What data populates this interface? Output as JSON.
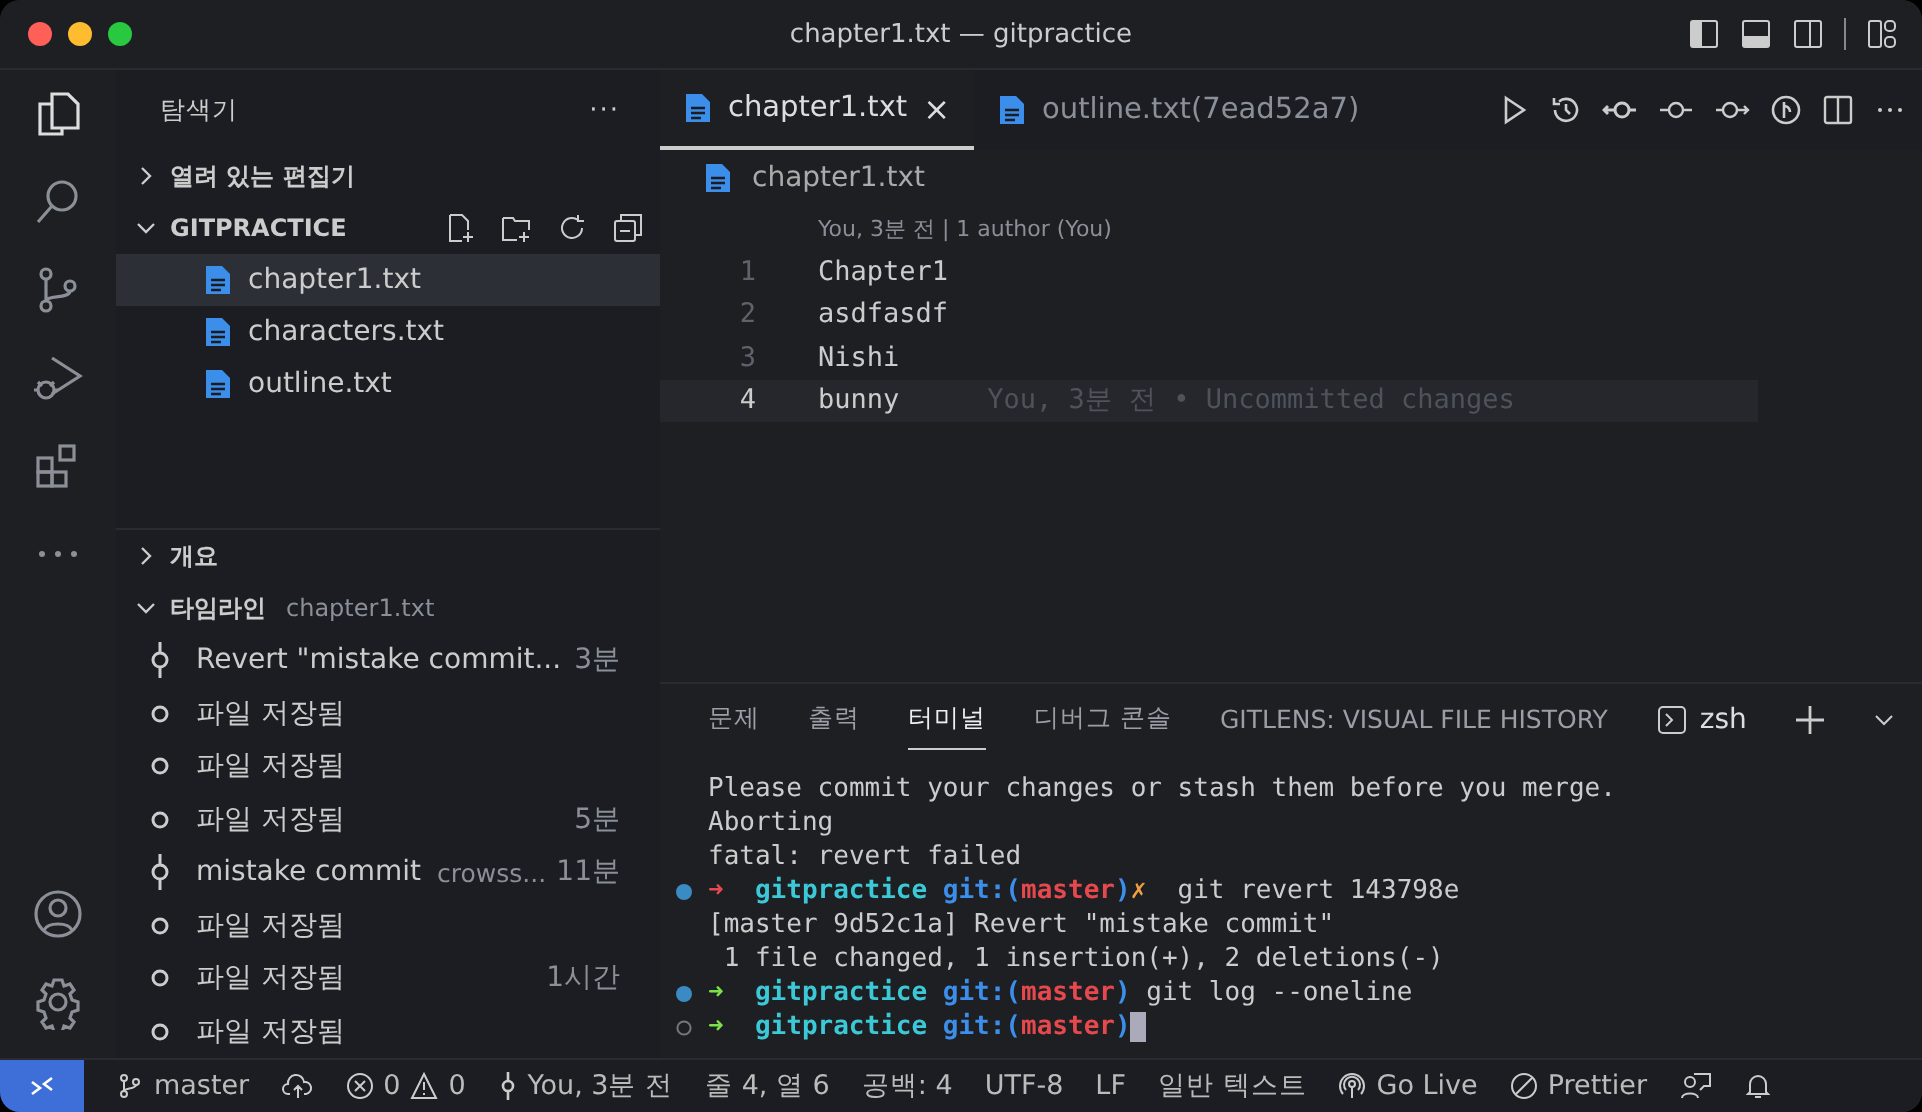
{
  "window": {
    "title": "chapter1.txt — gitpractice"
  },
  "activity_bar": {
    "items": [
      {
        "kind": "files",
        "selected": true
      },
      {
        "kind": "search",
        "selected": false
      },
      {
        "kind": "scm",
        "selected": false
      },
      {
        "kind": "debug",
        "selected": false
      },
      {
        "kind": "extensions",
        "selected": false
      },
      {
        "kind": "more",
        "selected": false
      }
    ]
  },
  "sidebar": {
    "title": "탐색기",
    "more": "···",
    "sections": [
      {
        "label": "열려 있는 편집기",
        "expanded": false
      }
    ],
    "folder": {
      "label": "GITPRACTICE",
      "expanded": true,
      "files": [
        {
          "name": "chapter1.txt",
          "selected": true
        },
        {
          "name": "characters.txt",
          "selected": false
        },
        {
          "name": "outline.txt",
          "selected": false
        }
      ]
    },
    "outline": {
      "label": "개요",
      "expanded": false
    },
    "timeline": {
      "label": "타임라인",
      "file": "chapter1.txt",
      "expanded": true,
      "items": [
        {
          "kind": "commit",
          "label": "Revert \"mistake commit...",
          "time": "3분"
        },
        {
          "kind": "save",
          "label": "파일 저장됨"
        },
        {
          "kind": "save",
          "label": "파일 저장됨"
        },
        {
          "kind": "save",
          "label": "파일 저장됨",
          "time": "5분"
        },
        {
          "kind": "commit",
          "label": "mistake commit",
          "author": "crowss...",
          "time": "11분"
        },
        {
          "kind": "save",
          "label": "파일 저장됨"
        },
        {
          "kind": "save",
          "label": "파일 저장됨",
          "time": "1시간"
        },
        {
          "kind": "save",
          "label": "파일 저장됨"
        }
      ]
    }
  },
  "tabs": [
    {
      "label": "chapter1.txt",
      "selected": true,
      "close": "×"
    },
    {
      "label": "outline.txt(7ead52a7)",
      "selected": false
    }
  ],
  "breadcrumb": "chapter1.txt",
  "blame_header": "You, 3분 전 | 1 author (You)",
  "code_lines": [
    {
      "number": "1",
      "text": "Chapter1",
      "current": false
    },
    {
      "number": "2",
      "text": "asdfasdf",
      "current": false
    },
    {
      "number": "3",
      "text": "Nishi",
      "current": false
    },
    {
      "number": "4",
      "text": "bunny",
      "current": true,
      "blame": "You, 3분 전 • Uncommitted changes"
    }
  ],
  "panel": {
    "tabs": [
      {
        "label": "문제",
        "selected": false
      },
      {
        "label": "출력",
        "selected": false
      },
      {
        "label": "터미널",
        "selected": true
      },
      {
        "label": "디버그 콘솔",
        "selected": false
      },
      {
        "label": "GITLENS: VISUAL FILE HISTORY",
        "selected": false
      }
    ],
    "shell": "zsh"
  },
  "terminal": [
    {
      "kind": "output",
      "segments": [
        {
          "kind": "plain",
          "text": "Please commit your changes or stash them before you merge."
        }
      ]
    },
    {
      "kind": "output",
      "segments": [
        {
          "kind": "plain",
          "text": "Aborting"
        }
      ]
    },
    {
      "kind": "output",
      "segments": [
        {
          "kind": "plain",
          "text": "fatal: revert failed"
        }
      ]
    },
    {
      "kind": "command",
      "segments": [
        {
          "kind": "arrow_fail",
          "text": "➜"
        },
        {
          "kind": "dir",
          "text": "gitpractice"
        },
        {
          "kind": "git",
          "text": "git:("
        },
        {
          "kind": "branch",
          "text": "master"
        },
        {
          "kind": "git",
          "text": ")"
        },
        {
          "kind": "dirty",
          "text": "✗"
        },
        {
          "kind": "plain",
          "text": "git revert 143798e"
        }
      ]
    },
    {
      "kind": "output",
      "segments": [
        {
          "kind": "plain",
          "text": "[master 9d52c1a] Revert \"mistake commit\""
        }
      ]
    },
    {
      "kind": "output",
      "segments": [
        {
          "kind": "plain",
          "text": " 1 file changed, 1 insertion(+), 2 deletions(-)"
        }
      ]
    },
    {
      "kind": "command",
      "segments": [
        {
          "kind": "arrow_ok",
          "text": "➜"
        },
        {
          "kind": "dir",
          "text": "gitpractice"
        },
        {
          "kind": "git",
          "text": "git:("
        },
        {
          "kind": "branch",
          "text": "master"
        },
        {
          "kind": "git",
          "text": ")"
        },
        {
          "kind": "plain",
          "text": "git log --oneline"
        }
      ]
    },
    {
      "kind": "prompt",
      "segments": [
        {
          "kind": "arrow_ok",
          "text": "➜"
        },
        {
          "kind": "dir",
          "text": "gitpractice"
        },
        {
          "kind": "git",
          "text": "git:("
        },
        {
          "kind": "branch",
          "text": "master"
        },
        {
          "kind": "git",
          "text": ")"
        },
        {
          "kind": "cursor"
        }
      ]
    }
  ],
  "status_bar": {
    "branch": "master",
    "errors": "0",
    "warnings": "0",
    "blame": "You, 3분 전",
    "position": "줄 4, 열 6",
    "spaces": "공백: 4",
    "encoding": "UTF-8",
    "eol": "LF",
    "language": "일반 텍스트",
    "go_live": "Go Live",
    "prettier": "Prettier"
  }
}
